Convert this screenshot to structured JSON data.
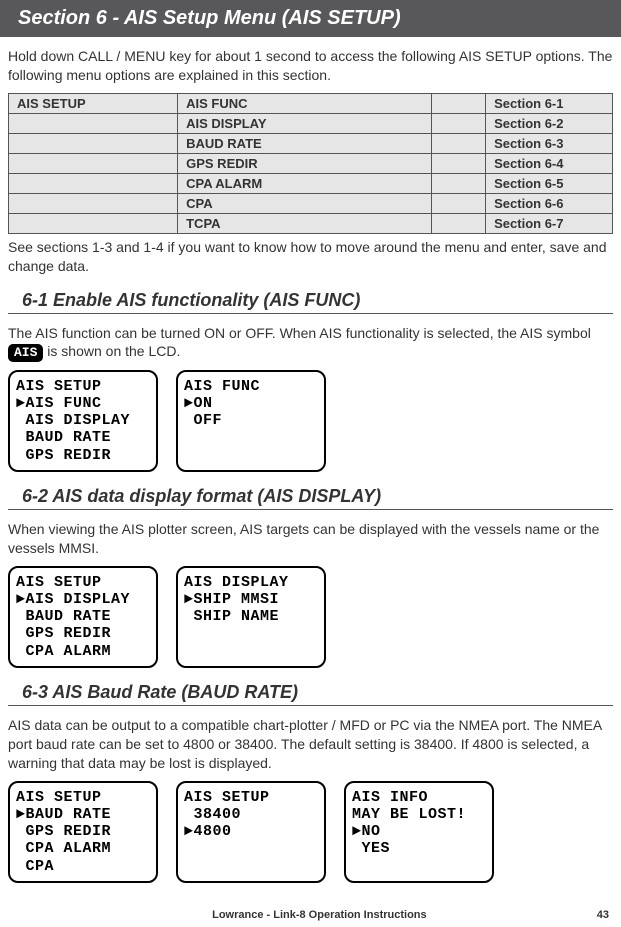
{
  "sectionBanner": "Section 6 - AIS Setup Menu (AIS SETUP)",
  "intro1": "Hold down CALL / MENU key for about 1 second to access the following AIS SETUP options. The following menu options are explained in this section.",
  "menuTable": {
    "rows": [
      {
        "c1": "AIS SETUP",
        "c2": "AIS FUNC",
        "c4": "Section 6-1"
      },
      {
        "c1": "",
        "c2": "AIS DISPLAY",
        "c4": "Section 6-2"
      },
      {
        "c1": "",
        "c2": "BAUD RATE",
        "c4": "Section 6-3"
      },
      {
        "c1": "",
        "c2": "GPS REDIR",
        "c4": "Section 6-4"
      },
      {
        "c1": "",
        "c2": "CPA ALARM",
        "c4": "Section 6-5"
      },
      {
        "c1": "",
        "c2": "CPA",
        "c4": "Section 6-6"
      },
      {
        "c1": "",
        "c2": "TCPA",
        "c4": "Section 6-7"
      }
    ]
  },
  "afterTable": "See sections 1-3 and 1-4 if you want to know how to move around the menu and enter, save and change data.",
  "sub61": {
    "title": "6-1 Enable AIS functionality (AIS FUNC)",
    "textBefore": "The AIS function can be turned ON or OFF.  When AIS functionality is selected, the AIS symbol ",
    "chip": "AIS",
    "textAfter": " is shown on the LCD.",
    "lcd1": "AIS SETUP\n►AIS FUNC\n AIS DISPLAY\n BAUD RATE\n GPS REDIR",
    "lcd2": "AIS FUNC\n►ON\n OFF\n\n "
  },
  "sub62": {
    "title": "6-2 AIS data display format (AIS DISPLAY)",
    "text": "When viewing the AIS plotter screen, AIS targets can be displayed with the vessels name or the vessels MMSI.",
    "lcd1": "AIS SETUP\n►AIS DISPLAY\n BAUD RATE\n GPS REDIR\n CPA ALARM",
    "lcd2": "AIS DISPLAY\n►SHIP MMSI\n SHIP NAME\n\n "
  },
  "sub63": {
    "title": "6-3 AIS Baud Rate (BAUD RATE)",
    "text": "AIS data can be output to a compatible chart-plotter / MFD or PC via the NMEA port. The NMEA port baud rate can be set to 4800 or 38400. The default setting is 38400. If 4800 is selected, a warning that data may be lost is displayed.",
    "lcd1": "AIS SETUP\n►BAUD RATE\n GPS REDIR\n CPA ALARM\n CPA",
    "lcd2": "AIS SETUP\n 38400\n►4800\n\n ",
    "lcd3": "AIS INFO\nMAY BE LOST!\n►NO\n YES\n "
  },
  "footer": {
    "center": "Lowrance - Link-8 Operation Instructions",
    "pageNum": "43"
  }
}
